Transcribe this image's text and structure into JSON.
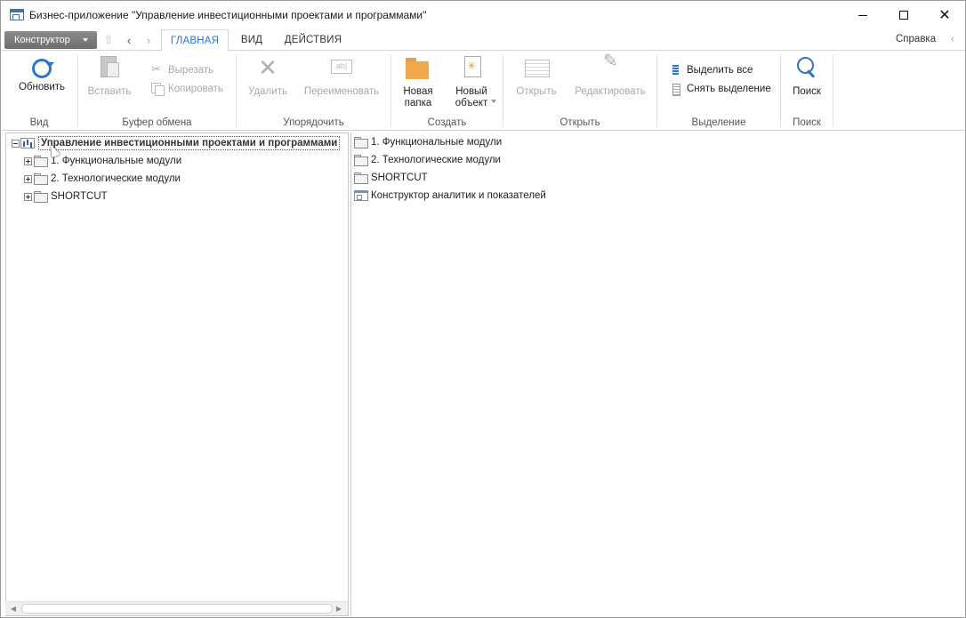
{
  "window": {
    "title": "Бизнес-приложение \"Управление инвестиционными проектами и программами\""
  },
  "toolbar": {
    "designer_label": "Конструктор",
    "tabs": [
      {
        "label": "ГЛАВНАЯ",
        "active": true
      },
      {
        "label": "ВИД",
        "active": false
      },
      {
        "label": "ДЕЙСТВИЯ",
        "active": false
      }
    ],
    "help_label": "Справка"
  },
  "ribbon": {
    "groups": {
      "view": {
        "label": "Вид",
        "refresh": "Обновить"
      },
      "clipboard": {
        "label": "Буфер обмена",
        "paste": "Вставить",
        "cut": "Вырезать",
        "copy": "Копировать"
      },
      "organize": {
        "label": "Упорядочить",
        "delete": "Удалить",
        "rename": "Переименовать"
      },
      "create": {
        "label": "Создать",
        "new_folder_1": "Новая",
        "new_folder_2": "папка",
        "new_object_1": "Новый",
        "new_object_2": "объект"
      },
      "open": {
        "label": "Открыть",
        "open": "Открыть",
        "edit": "Редактировать"
      },
      "selection": {
        "label": "Выделение",
        "select_all": "Выделить все",
        "deselect": "Снять выделение"
      },
      "search": {
        "label": "Поиск",
        "search": "Поиск"
      }
    }
  },
  "tree": {
    "root": "Управление инвестиционными проектами и программами",
    "items": [
      "1. Функциональные модули",
      "2. Технологические модули",
      "SHORTCUT"
    ]
  },
  "content": {
    "items": [
      {
        "label": "1. Функциональные модули",
        "icon": "folder-icon"
      },
      {
        "label": "2. Технологические модули",
        "icon": "folder-icon"
      },
      {
        "label": "SHORTCUT",
        "icon": "folder-icon"
      },
      {
        "label": "Конструктор аналитик и показателей",
        "icon": "app-icon"
      }
    ]
  },
  "colors": {
    "accent": "#2e75c8",
    "folder": "#f0a94a"
  }
}
